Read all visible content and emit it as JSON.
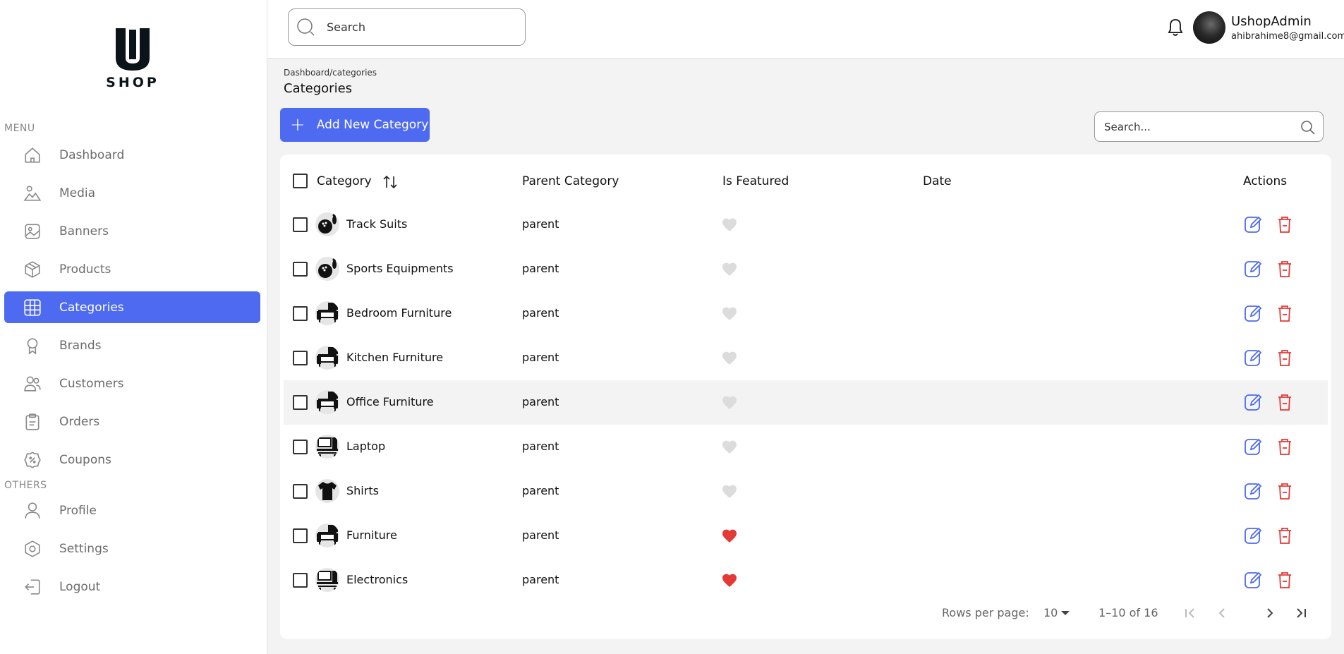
{
  "brand": {
    "logo_text": "SHOP"
  },
  "sidebar": {
    "menu_label": "MENU",
    "others_label": "OTHERS",
    "items": [
      {
        "label": "Dashboard",
        "icon": "home-icon"
      },
      {
        "label": "Media",
        "icon": "media-icon"
      },
      {
        "label": "Banners",
        "icon": "image-icon"
      },
      {
        "label": "Products",
        "icon": "box-icon"
      },
      {
        "label": "Categories",
        "icon": "grid-icon",
        "active": true
      },
      {
        "label": "Brands",
        "icon": "badge-icon"
      },
      {
        "label": "Customers",
        "icon": "users-icon"
      },
      {
        "label": "Orders",
        "icon": "clipboard-icon"
      },
      {
        "label": "Coupons",
        "icon": "coupon-icon"
      }
    ],
    "others": [
      {
        "label": "Profile",
        "icon": "user-icon"
      },
      {
        "label": "Settings",
        "icon": "settings-icon"
      },
      {
        "label": "Logout",
        "icon": "logout-icon"
      }
    ]
  },
  "topbar": {
    "search_placeholder": "Search",
    "user_name": "UshopAdmin",
    "user_email": "ahibrahime8@gmail.com"
  },
  "page": {
    "breadcrumb": "Dashboard/categories",
    "title": "Categories",
    "add_button": "Add New Category",
    "table_search_placeholder": "Search..."
  },
  "table": {
    "columns": [
      "Category",
      "Parent Category",
      "Is Featured",
      "Date",
      "Actions"
    ],
    "rows": [
      {
        "name": "Track Suits",
        "parent": "parent",
        "featured": false,
        "thumb": "sports"
      },
      {
        "name": "Sports Equipments",
        "parent": "parent",
        "featured": false,
        "thumb": "sports"
      },
      {
        "name": "Bedroom Furniture",
        "parent": "parent",
        "featured": false,
        "thumb": "furniture"
      },
      {
        "name": "Kitchen Furniture",
        "parent": "parent",
        "featured": false,
        "thumb": "furniture"
      },
      {
        "name": "Office Furniture",
        "parent": "parent",
        "featured": false,
        "thumb": "furniture"
      },
      {
        "name": "Laptop",
        "parent": "parent",
        "featured": false,
        "thumb": "electronics"
      },
      {
        "name": "Shirts",
        "parent": "parent",
        "featured": false,
        "thumb": "shirt"
      },
      {
        "name": "Furniture",
        "parent": "parent",
        "featured": true,
        "thumb": "furniture"
      },
      {
        "name": "Electronics",
        "parent": "parent",
        "featured": true,
        "thumb": "electronics"
      }
    ]
  },
  "pagination": {
    "rows_per_page_label": "Rows per page:",
    "rows_per_page": "10",
    "range": "1–10 of 16"
  },
  "colors": {
    "accent": "#4d6af0",
    "danger": "#e53935",
    "heart_on": "#e53935",
    "heart_off": "#dcdcdc"
  }
}
